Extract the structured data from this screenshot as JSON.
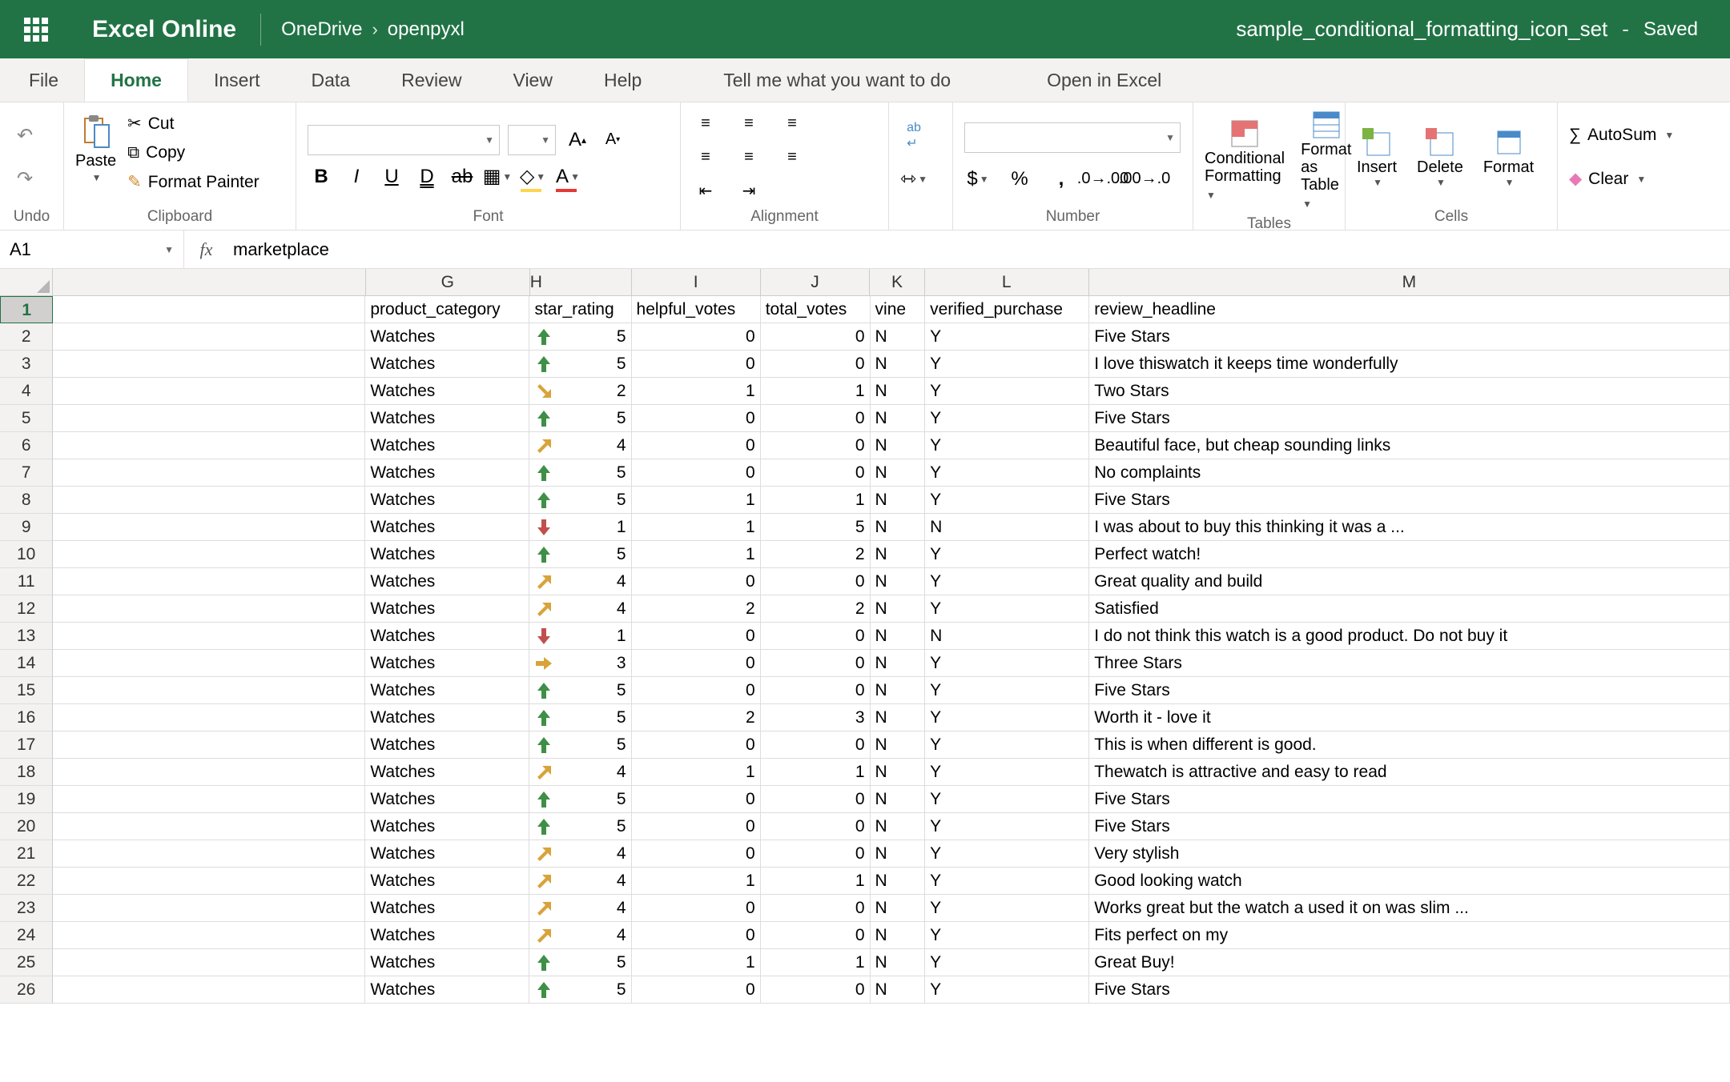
{
  "titlebar": {
    "app_name": "Excel Online",
    "breadcrumb1": "OneDrive",
    "breadcrumb2": "openpyxl",
    "doc_title": "sample_conditional_formatting_icon_set",
    "saved": "Saved"
  },
  "tabs": {
    "file": "File",
    "home": "Home",
    "insert": "Insert",
    "data": "Data",
    "review": "Review",
    "view": "View",
    "help": "Help",
    "tell": "Tell me what you want to do",
    "open": "Open in Excel"
  },
  "ribbon": {
    "undo_group": "Undo",
    "paste": "Paste",
    "cut": "Cut",
    "copy": "Copy",
    "format_painter": "Format Painter",
    "clipboard_group": "Clipboard",
    "font_group": "Font",
    "alignment_group": "Alignment",
    "number_group": "Number",
    "cond_format1": "Conditional",
    "cond_format2": "Formatting",
    "fmt_table1": "Format",
    "fmt_table2": "as Table",
    "tables_group": "Tables",
    "insert": "Insert",
    "delete": "Delete",
    "format": "Format",
    "cells_group": "Cells",
    "autosum": "AutoSum",
    "clear": "Clear"
  },
  "fbar": {
    "namebox": "A1",
    "formula": "marketplace"
  },
  "grid": {
    "columns": [
      {
        "id": "G",
        "w": "c-G",
        "label": "G",
        "header": "product_category"
      },
      {
        "id": "H",
        "w": "c-H",
        "label": "H",
        "header": "star_rating"
      },
      {
        "id": "I",
        "w": "c-I",
        "label": "I",
        "header": "helpful_votes"
      },
      {
        "id": "J",
        "w": "c-J",
        "label": "J",
        "header": "total_votes"
      },
      {
        "id": "K",
        "w": "c-K",
        "label": "K",
        "header": "vine"
      },
      {
        "id": "L",
        "w": "c-L",
        "label": "L",
        "header": "verified_purchase"
      },
      {
        "id": "M",
        "w": "c-M",
        "label": "M",
        "header": "review_headline"
      }
    ],
    "rows": [
      {
        "n": 2,
        "G": "Watches",
        "icon": "up",
        "H": 5,
        "I": 0,
        "J": 0,
        "K": "N",
        "L": "Y",
        "M": "Five Stars"
      },
      {
        "n": 3,
        "G": "Watches",
        "icon": "up",
        "H": 5,
        "I": 0,
        "J": 0,
        "K": "N",
        "L": "Y",
        "M": "I love thiswatch it keeps time wonderfully"
      },
      {
        "n": 4,
        "G": "Watches",
        "icon": "rd",
        "H": 2,
        "I": 1,
        "J": 1,
        "K": "N",
        "L": "Y",
        "M": "Two Stars"
      },
      {
        "n": 5,
        "G": "Watches",
        "icon": "up",
        "H": 5,
        "I": 0,
        "J": 0,
        "K": "N",
        "L": "Y",
        "M": "Five Stars"
      },
      {
        "n": 6,
        "G": "Watches",
        "icon": "ru",
        "H": 4,
        "I": 0,
        "J": 0,
        "K": "N",
        "L": "Y",
        "M": "Beautiful face, but cheap sounding links"
      },
      {
        "n": 7,
        "G": "Watches",
        "icon": "up",
        "H": 5,
        "I": 0,
        "J": 0,
        "K": "N",
        "L": "Y",
        "M": "No complaints"
      },
      {
        "n": 8,
        "G": "Watches",
        "icon": "up",
        "H": 5,
        "I": 1,
        "J": 1,
        "K": "N",
        "L": "Y",
        "M": "Five Stars"
      },
      {
        "n": 9,
        "G": "Watches",
        "icon": "dn",
        "H": 1,
        "I": 1,
        "J": 5,
        "K": "N",
        "L": "N",
        "M": "I was about to buy this thinking it was a ..."
      },
      {
        "n": 10,
        "G": "Watches",
        "icon": "up",
        "H": 5,
        "I": 1,
        "J": 2,
        "K": "N",
        "L": "Y",
        "M": "Perfect watch!"
      },
      {
        "n": 11,
        "G": "Watches",
        "icon": "ru",
        "H": 4,
        "I": 0,
        "J": 0,
        "K": "N",
        "L": "Y",
        "M": "Great quality and build"
      },
      {
        "n": 12,
        "G": "Watches",
        "icon": "ru",
        "H": 4,
        "I": 2,
        "J": 2,
        "K": "N",
        "L": "Y",
        "M": "Satisfied"
      },
      {
        "n": 13,
        "G": "Watches",
        "icon": "dn",
        "H": 1,
        "I": 0,
        "J": 0,
        "K": "N",
        "L": "N",
        "M": "I do not think this watch is a good product. Do not buy it"
      },
      {
        "n": 14,
        "G": "Watches",
        "icon": "rt",
        "H": 3,
        "I": 0,
        "J": 0,
        "K": "N",
        "L": "Y",
        "M": "Three Stars"
      },
      {
        "n": 15,
        "G": "Watches",
        "icon": "up",
        "H": 5,
        "I": 0,
        "J": 0,
        "K": "N",
        "L": "Y",
        "M": "Five Stars"
      },
      {
        "n": 16,
        "G": "Watches",
        "icon": "up",
        "H": 5,
        "I": 2,
        "J": 3,
        "K": "N",
        "L": "Y",
        "M": "Worth it - love it"
      },
      {
        "n": 17,
        "G": "Watches",
        "icon": "up",
        "H": 5,
        "I": 0,
        "J": 0,
        "K": "N",
        "L": "Y",
        "M": "This is when different is good."
      },
      {
        "n": 18,
        "G": "Watches",
        "icon": "ru",
        "H": 4,
        "I": 1,
        "J": 1,
        "K": "N",
        "L": "Y",
        "M": "Thewatch is attractive and easy to read"
      },
      {
        "n": 19,
        "G": "Watches",
        "icon": "up",
        "H": 5,
        "I": 0,
        "J": 0,
        "K": "N",
        "L": "Y",
        "M": "Five Stars"
      },
      {
        "n": 20,
        "G": "Watches",
        "icon": "up",
        "H": 5,
        "I": 0,
        "J": 0,
        "K": "N",
        "L": "Y",
        "M": "Five Stars"
      },
      {
        "n": 21,
        "G": "Watches",
        "icon": "ru",
        "H": 4,
        "I": 0,
        "J": 0,
        "K": "N",
        "L": "Y",
        "M": "Very stylish"
      },
      {
        "n": 22,
        "G": "Watches",
        "icon": "ru",
        "H": 4,
        "I": 1,
        "J": 1,
        "K": "N",
        "L": "Y",
        "M": "Good looking watch"
      },
      {
        "n": 23,
        "G": "Watches",
        "icon": "ru",
        "H": 4,
        "I": 0,
        "J": 0,
        "K": "N",
        "L": "Y",
        "M": "Works great but the watch a used it on was slim ..."
      },
      {
        "n": 24,
        "G": "Watches",
        "icon": "ru",
        "H": 4,
        "I": 0,
        "J": 0,
        "K": "N",
        "L": "Y",
        "M": "Fits perfect on my"
      },
      {
        "n": 25,
        "G": "Watches",
        "icon": "up",
        "H": 5,
        "I": 1,
        "J": 1,
        "K": "N",
        "L": "Y",
        "M": "Great Buy!"
      },
      {
        "n": 26,
        "G": "Watches",
        "icon": "up",
        "H": 5,
        "I": 0,
        "J": 0,
        "K": "N",
        "L": "Y",
        "M": "Five Stars"
      }
    ]
  },
  "colors": {
    "icon_up": "#3f8f46",
    "icon_ru": "#d8a33a",
    "icon_rt": "#d8a33a",
    "icon_rd": "#d8a33a",
    "icon_dn": "#c0504d"
  }
}
